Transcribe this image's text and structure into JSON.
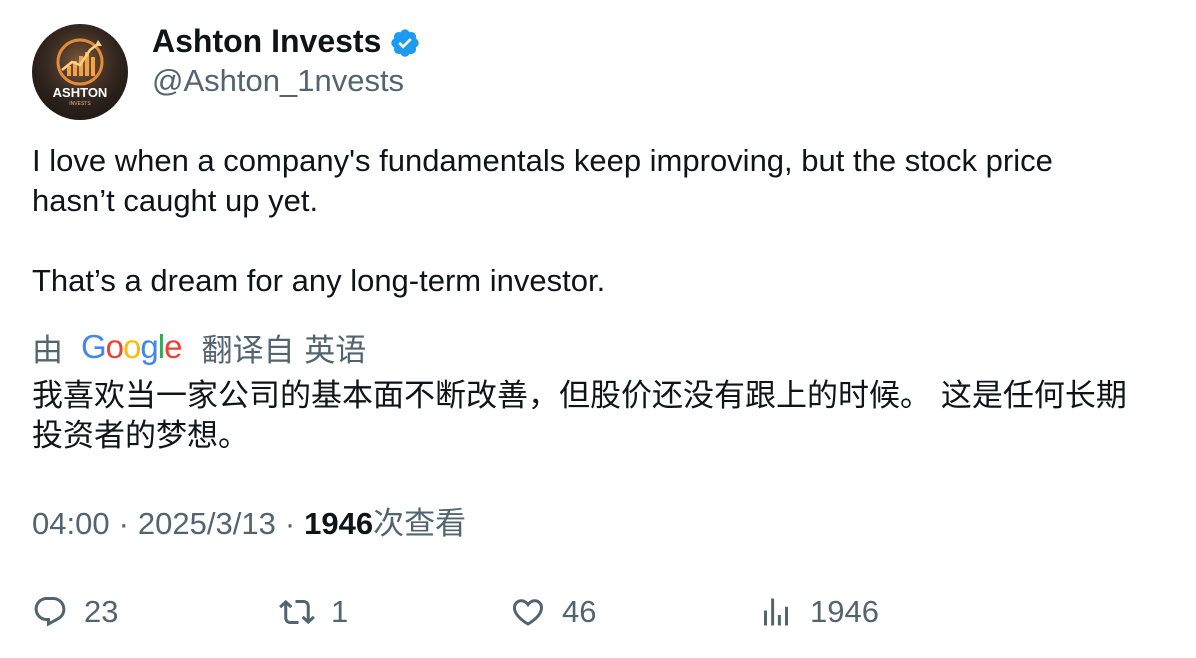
{
  "author": {
    "display_name": "Ashton Invests",
    "handle": "@Ashton_1nvests",
    "verified": true,
    "avatar_icon": "ashton-invests-logo",
    "avatar_text": "ASHTON",
    "avatar_subtext": "INVESTS"
  },
  "tweet": {
    "lines": [
      "I love when a company's fundamentals keep improving, but the stock price",
      "hasn’t caught up yet.",
      "That’s a dream for any long-term investor."
    ]
  },
  "translation": {
    "by_label": "由",
    "provider": "Google",
    "from_label": "翻译自 英语",
    "lines": [
      "我喜欢当一家公司的基本面不断改善，但股价还没有跟上的时候。 这是任何长期",
      "投资者的梦想。"
    ]
  },
  "meta": {
    "time": "04:00",
    "separator": "·",
    "date": "2025/3/13",
    "views_count": "1946",
    "views_label": "次查看"
  },
  "actions": {
    "replies": "23",
    "retweets": "1",
    "likes": "46",
    "views": "1946"
  },
  "colors": {
    "text": "#0f1419",
    "secondary": "#536471",
    "verified": "#1d9bf0"
  }
}
